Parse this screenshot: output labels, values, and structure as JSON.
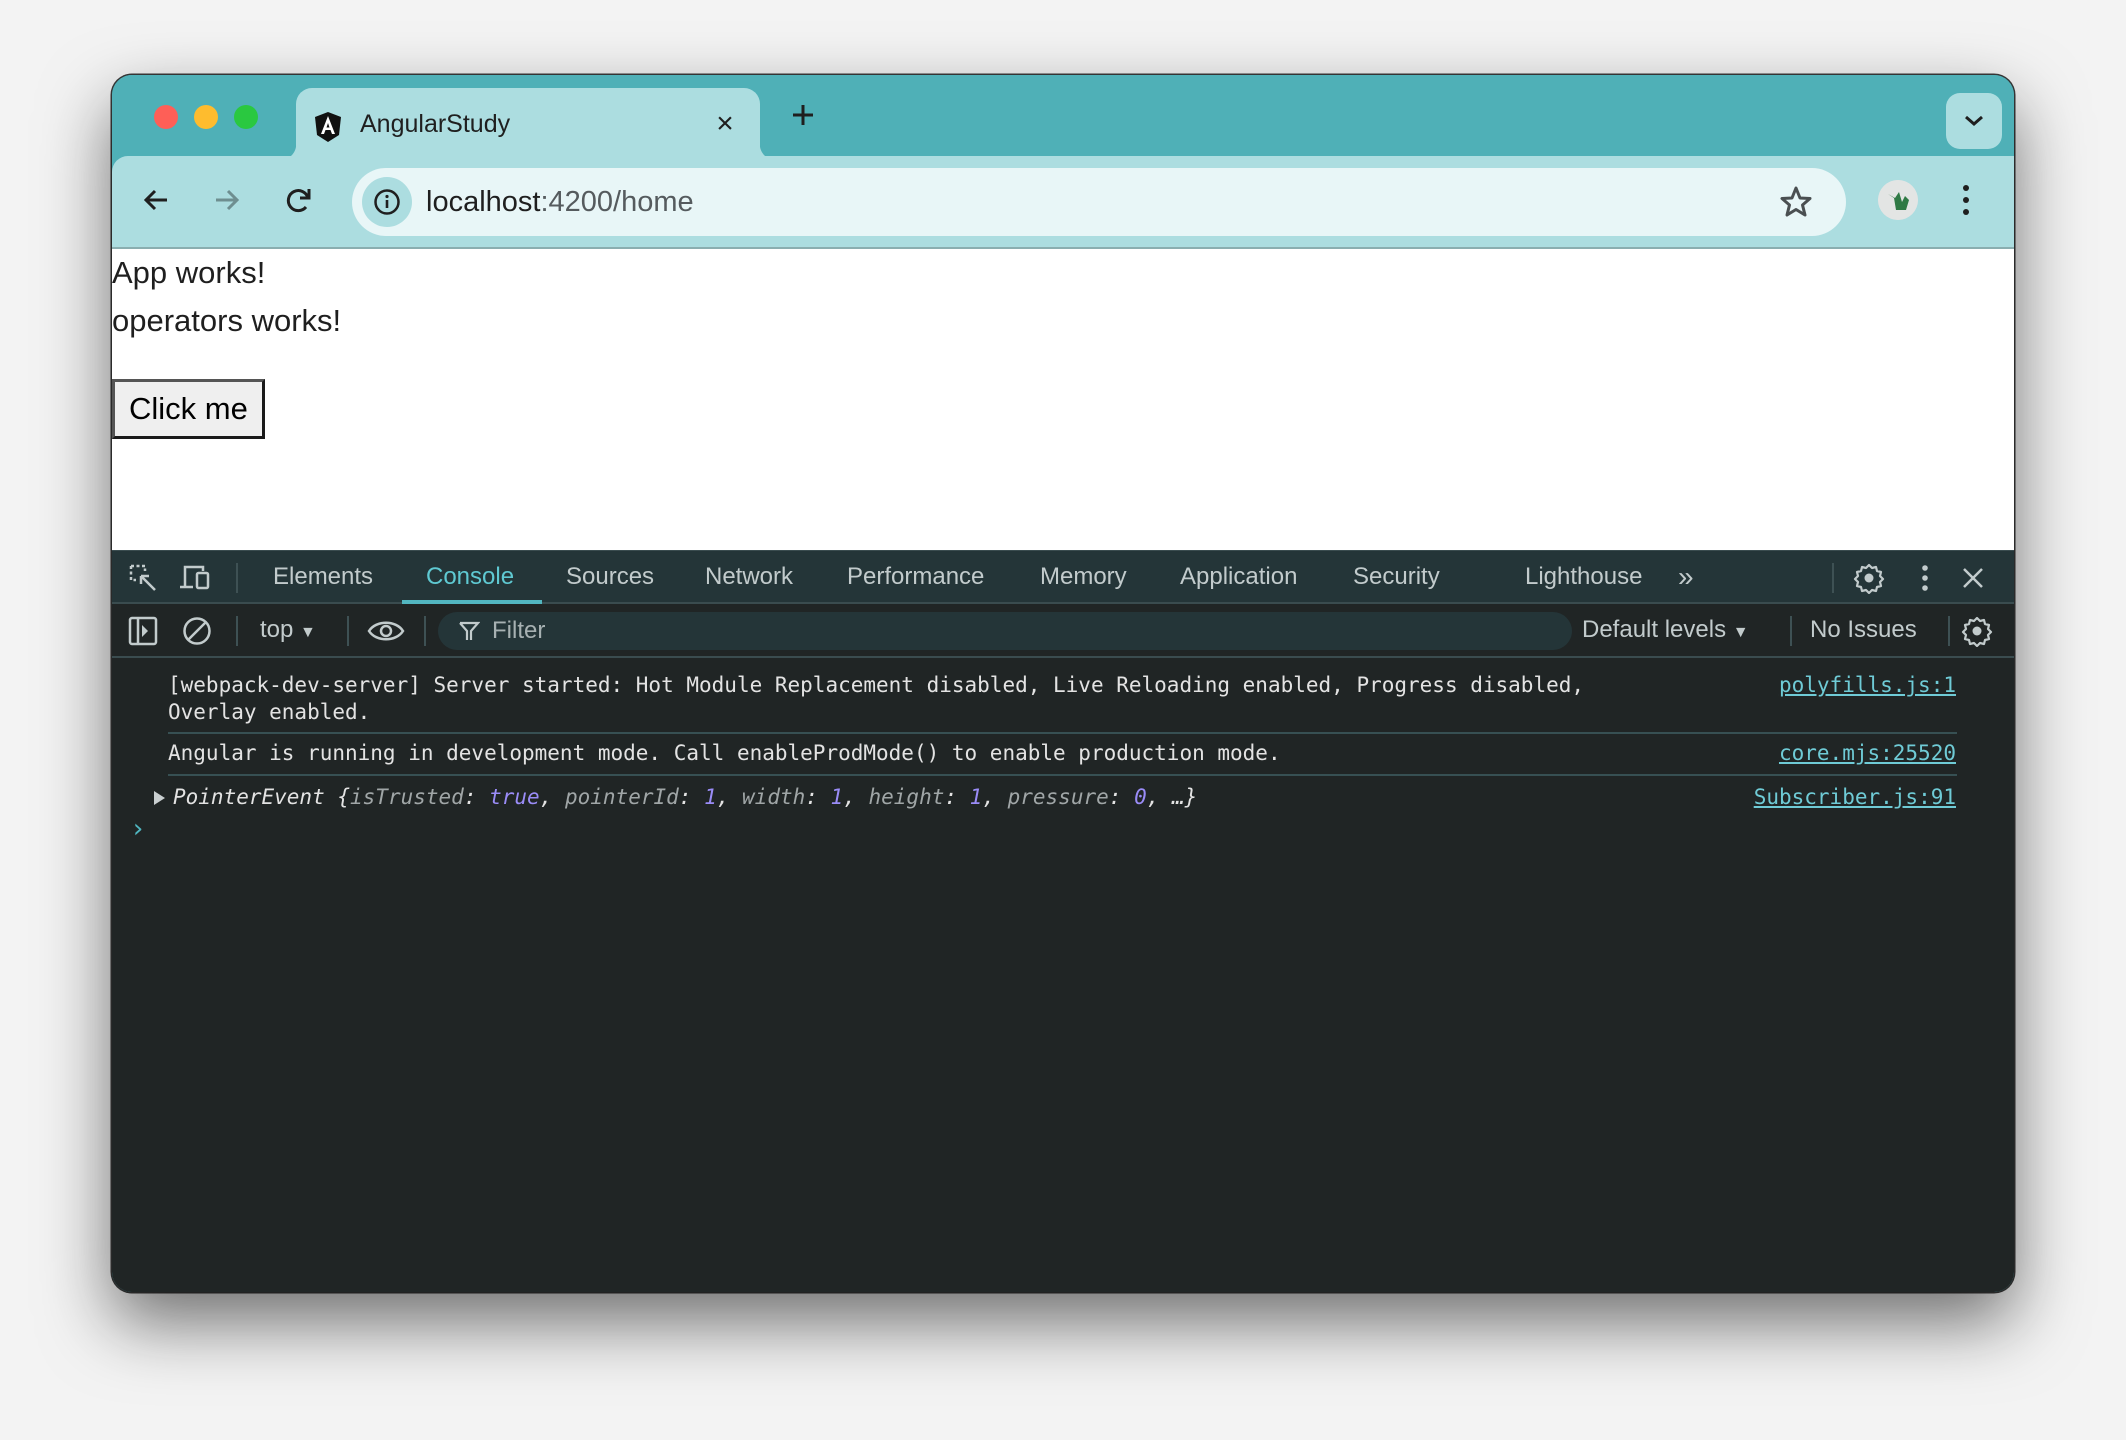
{
  "browser": {
    "tab": {
      "title": "AngularStudy",
      "favicon": "angular-logo-icon",
      "close_icon": "close-icon"
    },
    "new_tab_icon": "plus-icon",
    "tab_search_icon": "chevron-down-icon",
    "toolbar": {
      "back_icon": "arrow-left-icon",
      "forward_icon": "arrow-right-icon",
      "reload_icon": "reload-icon",
      "site_info_icon": "info-icon",
      "url_host": "localhost",
      "url_rest": ":4200/home",
      "bookmark_icon": "star-icon",
      "profile_icon": "avatar-icon",
      "menu_icon": "kebab-menu-icon"
    }
  },
  "page": {
    "lines": [
      "App works!",
      "operators works!"
    ],
    "button_label": "Click me"
  },
  "devtools": {
    "tabs": [
      "Elements",
      "Console",
      "Sources",
      "Network",
      "Performance",
      "Memory",
      "Application",
      "Security",
      "Lighthouse"
    ],
    "active_tab": "Console",
    "more_tabs": "»",
    "console_toolbar": {
      "context": "top",
      "filter_placeholder": "Filter",
      "levels": "Default levels",
      "issues": "No Issues"
    },
    "messages": [
      {
        "text_line1": "[webpack-dev-server] Server started: Hot Module Replacement disabled, Live Reloading enabled, Progress disabled,",
        "text_line2": "Overlay enabled.",
        "source": "polyfills.js:1"
      },
      {
        "text": "Angular is running in development mode. Call enableProdMode() to enable production mode.",
        "source": "core.mjs:25520"
      },
      {
        "object_name": "PointerEvent",
        "props": [
          {
            "key": "isTrusted",
            "value": "true"
          },
          {
            "key": "pointerId",
            "value": "1"
          },
          {
            "key": "width",
            "value": "1"
          },
          {
            "key": "height",
            "value": "1"
          },
          {
            "key": "pressure",
            "value": "0"
          }
        ],
        "ellipsis": "…",
        "source": "Subscriber.js:91"
      }
    ],
    "prompt": "›"
  },
  "colors": {
    "frame": "#4fb0b7",
    "toolbar": "#acdde0",
    "omnibox": "#e8f6f7",
    "devtools_bg": "#202525",
    "accent": "#5fc9d2",
    "value_purple": "#9a8cf7"
  }
}
